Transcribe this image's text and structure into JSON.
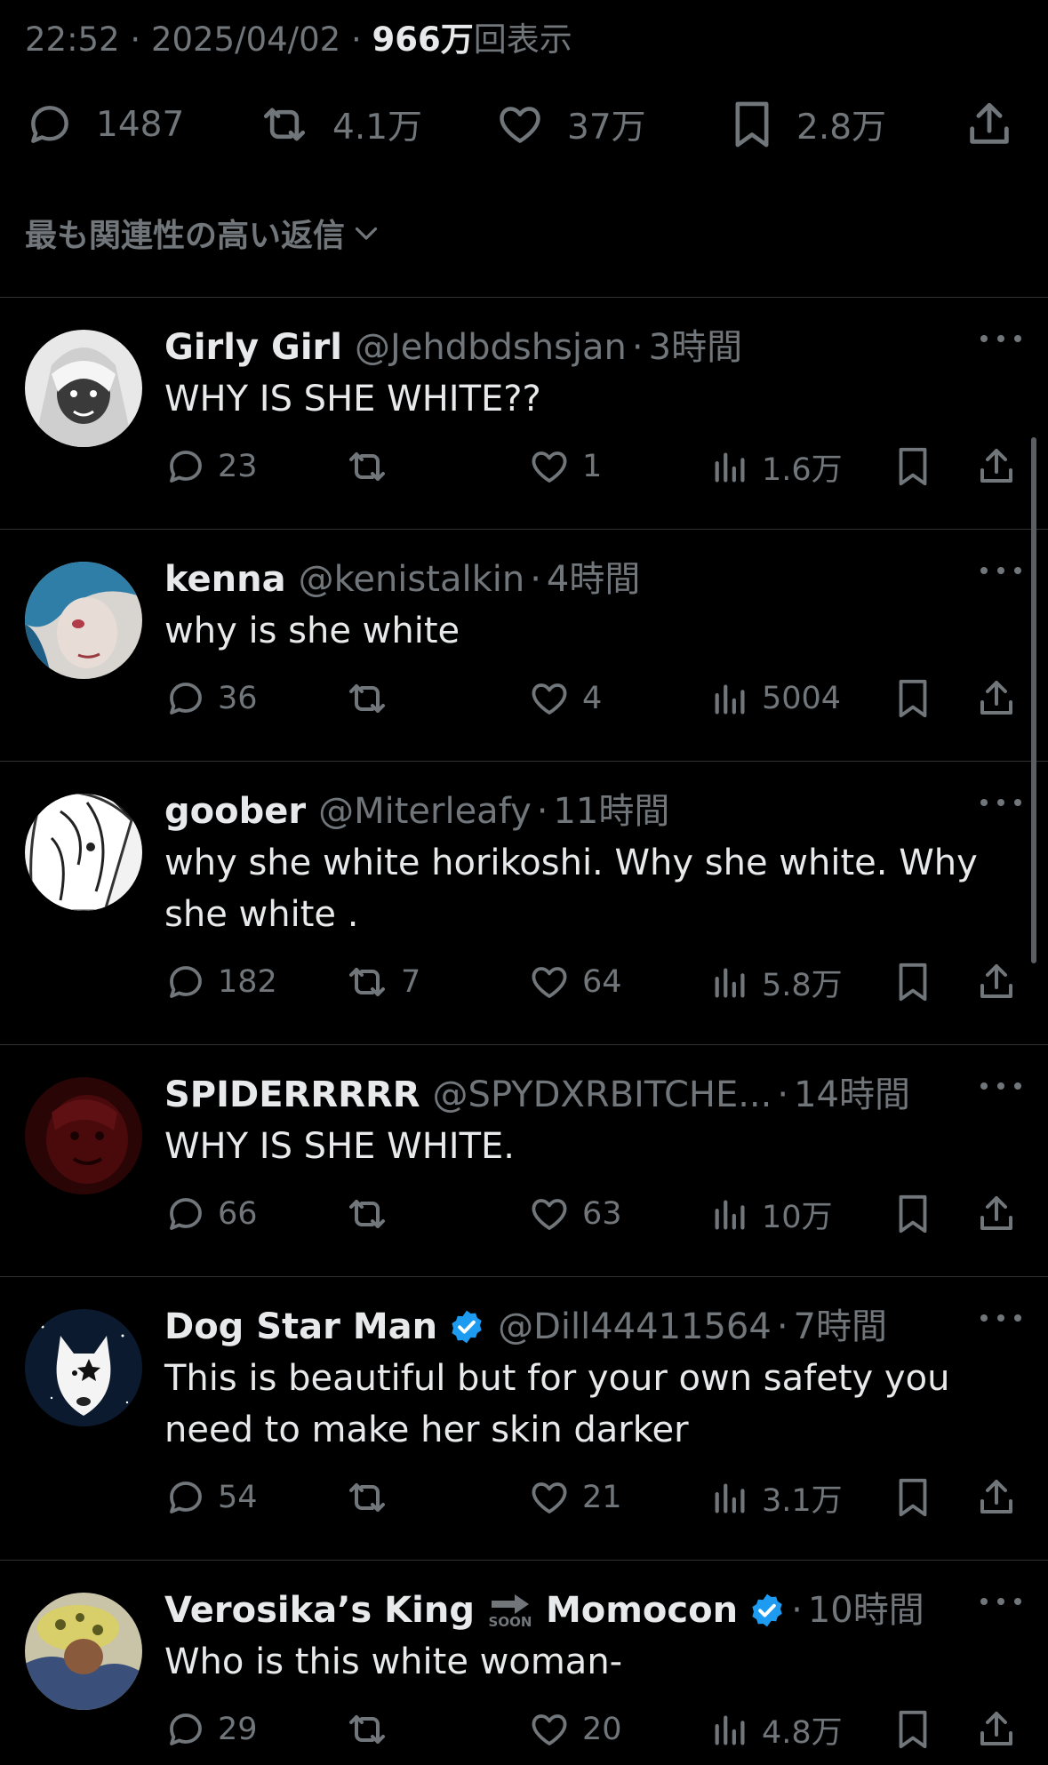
{
  "post_meta": {
    "time": "22:52",
    "date": "2025/04/02",
    "views_count": "966万",
    "views_label": "回表示"
  },
  "main_actions": {
    "replies": "1487",
    "reposts": "4.1万",
    "likes": "37万",
    "bookmarks": "2.8万"
  },
  "sort_label": "最も関連性の高い返信",
  "replies": [
    {
      "name": "Girly Girl",
      "handle": "@Jehdbdshsjan",
      "time": "3時間",
      "text": "WHY IS SHE WHITE??",
      "replies": "23",
      "reposts": "",
      "likes": "1",
      "views": "1.6万"
    },
    {
      "name": "kenna",
      "handle": "@kenistalkin",
      "time": "4時間",
      "text": "why is she white",
      "replies": "36",
      "reposts": "",
      "likes": "4",
      "views": "5004"
    },
    {
      "name": "goober",
      "handle": "@Miterleafy",
      "time": "11時間",
      "text": "why she white horikoshi. Why she white. Why she white .",
      "replies": "182",
      "reposts": "7",
      "likes": "64",
      "views": "5.8万"
    },
    {
      "name": "SPIDERRRRR",
      "handle": "@SPYDXRBITCHE...",
      "time": "14時間",
      "text": "WHY IS SHE WHITE.",
      "replies": "66",
      "reposts": "",
      "likes": "63",
      "views": "10万"
    },
    {
      "name": "Dog Star Man",
      "handle": "@Dill44411564",
      "time": "7時間",
      "text": "This is beautiful but for your own safety you need to make her skin darker",
      "replies": "54",
      "reposts": "",
      "likes": "21",
      "views": "3.1万"
    },
    {
      "name": "Verosika’s King",
      "name2": "Momocon",
      "soon": "SOON",
      "time": "10時間",
      "text": "Who is this white woman-",
      "replies": "29",
      "reposts": "",
      "likes": "20",
      "views": "4.8万"
    }
  ],
  "colors": {
    "background": "#000000",
    "text": "#e7e9ea",
    "muted": "#71767b",
    "divider": "#2f3336",
    "verified": "#1d9bf0"
  }
}
